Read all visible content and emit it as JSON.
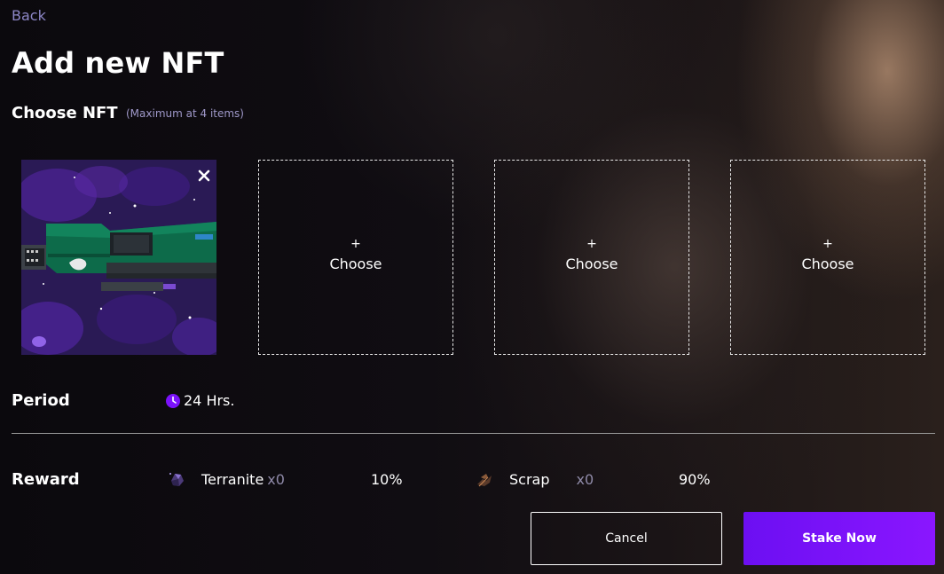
{
  "nav": {
    "back_label": "Back"
  },
  "page": {
    "title": "Add new NFT"
  },
  "choose_nft": {
    "label": "Choose NFT",
    "hint": "(Maximum at 4 items)",
    "empty_slot": {
      "plus": "+",
      "label": "Choose"
    }
  },
  "period": {
    "label": "Period",
    "value": "24 Hrs."
  },
  "reward": {
    "label": "Reward",
    "items": [
      {
        "name": "Terranite",
        "qty": "x0",
        "percent": "10%",
        "icon": "terranite-icon"
      },
      {
        "name": "Scrap",
        "qty": "x0",
        "percent": "90%",
        "icon": "scrap-icon"
      }
    ]
  },
  "actions": {
    "cancel_label": "Cancel",
    "stake_label": "Stake Now"
  },
  "colors": {
    "accent": "#7b12fa",
    "link": "#8c86c6",
    "muted": "#8f8aa8"
  }
}
